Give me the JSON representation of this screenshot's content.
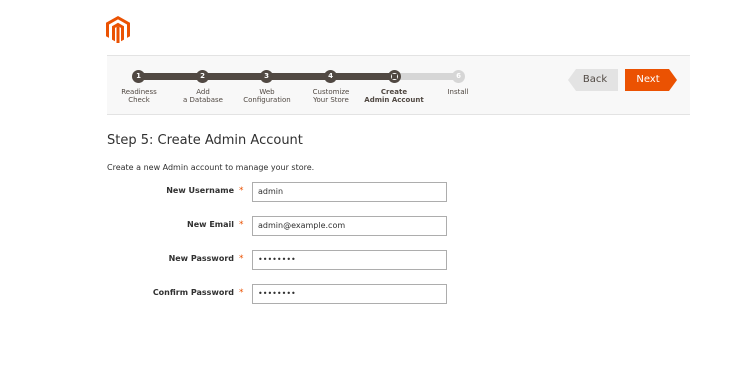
{
  "brand": {
    "logo_icon": "magento-logo-icon",
    "accent": "#eb5202",
    "dark": "#514943"
  },
  "progress": {
    "steps": [
      {
        "number": "1",
        "label": "Readiness\nCheck",
        "state": "complete"
      },
      {
        "number": "2",
        "label": "Add\na Database",
        "state": "complete"
      },
      {
        "number": "3",
        "label": "Web\nConfiguration",
        "state": "complete"
      },
      {
        "number": "4",
        "label": "Customize\nYour Store",
        "state": "complete"
      },
      {
        "number": "5",
        "label": "Create\nAdmin Account",
        "state": "current"
      },
      {
        "number": "6",
        "label": "Install",
        "state": "pending"
      }
    ]
  },
  "nav": {
    "back_label": "Back",
    "next_label": "Next"
  },
  "page": {
    "title": "Step 5: Create Admin Account",
    "intro": "Create a new Admin account to manage your store."
  },
  "form": {
    "required_marker": "*",
    "fields": [
      {
        "label": "New Username",
        "value": "admin"
      },
      {
        "label": "New Email",
        "value": "admin@example.com"
      },
      {
        "label": "New Password",
        "value": "••••••••"
      },
      {
        "label": "Confirm Password",
        "value": "••••••••"
      }
    ]
  }
}
